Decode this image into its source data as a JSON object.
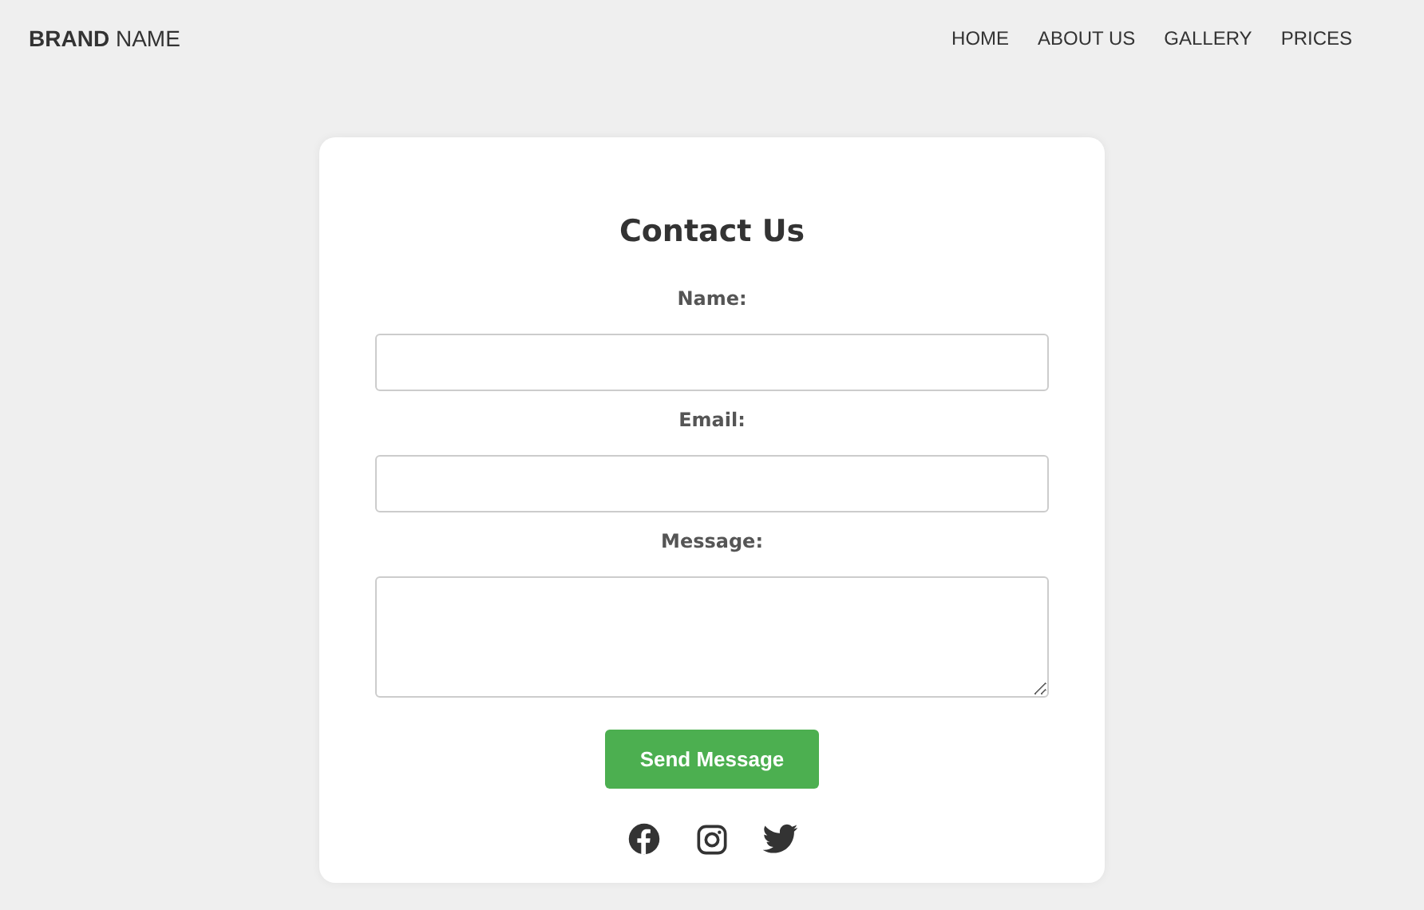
{
  "brand": "**BRAND** NAME",
  "nav": [
    "HOME",
    "ABOUT US",
    "GALLERY",
    "PRICES"
  ],
  "form": {
    "title": "Contact Us",
    "fields": [
      {
        "label": "Name:",
        "kind": "input"
      },
      {
        "label": "Email:",
        "kind": "input"
      },
      {
        "label": "Message:",
        "kind": "textarea"
      }
    ],
    "submit": "Send Message"
  },
  "social_links": [
    {
      "kind": "facebook"
    },
    {
      "kind": "instagram"
    },
    {
      "kind": "twitter"
    }
  ]
}
